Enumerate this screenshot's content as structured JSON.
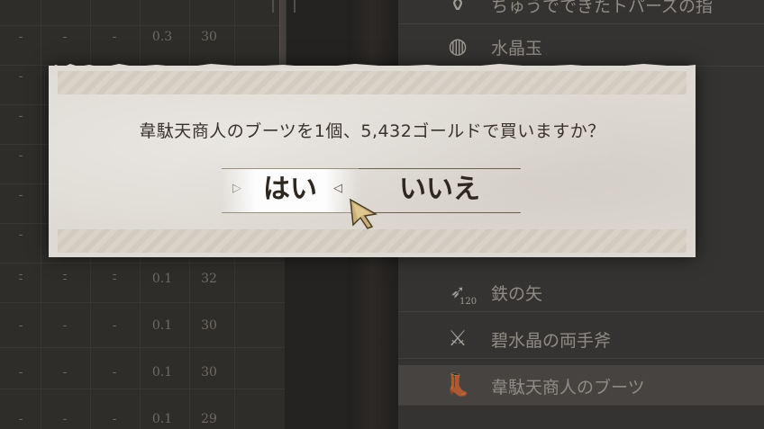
{
  "background_table": {
    "rows": [
      [
        "-",
        "-",
        "-",
        "0.3",
        "30"
      ],
      [
        "-",
        "-",
        "-",
        "",
        ""
      ],
      [
        "-",
        "-",
        "-",
        "",
        ""
      ],
      [
        "-",
        "-",
        "-",
        "",
        ""
      ],
      [
        "-",
        "-",
        "-",
        "",
        ""
      ],
      [
        "-",
        "-",
        "-",
        "",
        ""
      ],
      [
        "-",
        "-",
        "-",
        "",
        ""
      ],
      [
        "-",
        "-",
        "-",
        "0.1",
        "32"
      ],
      [
        "-",
        "-",
        "-",
        "0.1",
        "30"
      ],
      [
        "-",
        "-",
        "-",
        "0.1",
        "30"
      ],
      [
        "-",
        "-",
        "-",
        "0.1",
        "29"
      ]
    ]
  },
  "item_list": [
    {
      "label": "ちゅうでできたトパーズの指",
      "icon": "coin-pouch-icon"
    },
    {
      "label": "水晶玉",
      "icon": "crystal-ball-icon"
    },
    {
      "label": "",
      "icon": ""
    },
    {
      "label": "",
      "icon": ""
    },
    {
      "label": "",
      "icon": ""
    },
    {
      "label": "",
      "icon": ""
    },
    {
      "label": "鉄の矢",
      "icon": "arrow-icon",
      "qty": "120"
    },
    {
      "label": "碧水晶の両手斧",
      "icon": "battle-axe-icon"
    },
    {
      "label": "韋駄天商人のブーツ",
      "icon": "boots-icon",
      "selected": true
    }
  ],
  "dialog": {
    "message": "韋駄天商人のブーツを1個、5,432ゴールドで買いますか？",
    "yes_label": "はい",
    "no_label": "いいえ",
    "selected": "yes",
    "colors": {
      "paper": "#dedad3",
      "text": "#3a332b",
      "highlight": "#ffffff"
    }
  }
}
